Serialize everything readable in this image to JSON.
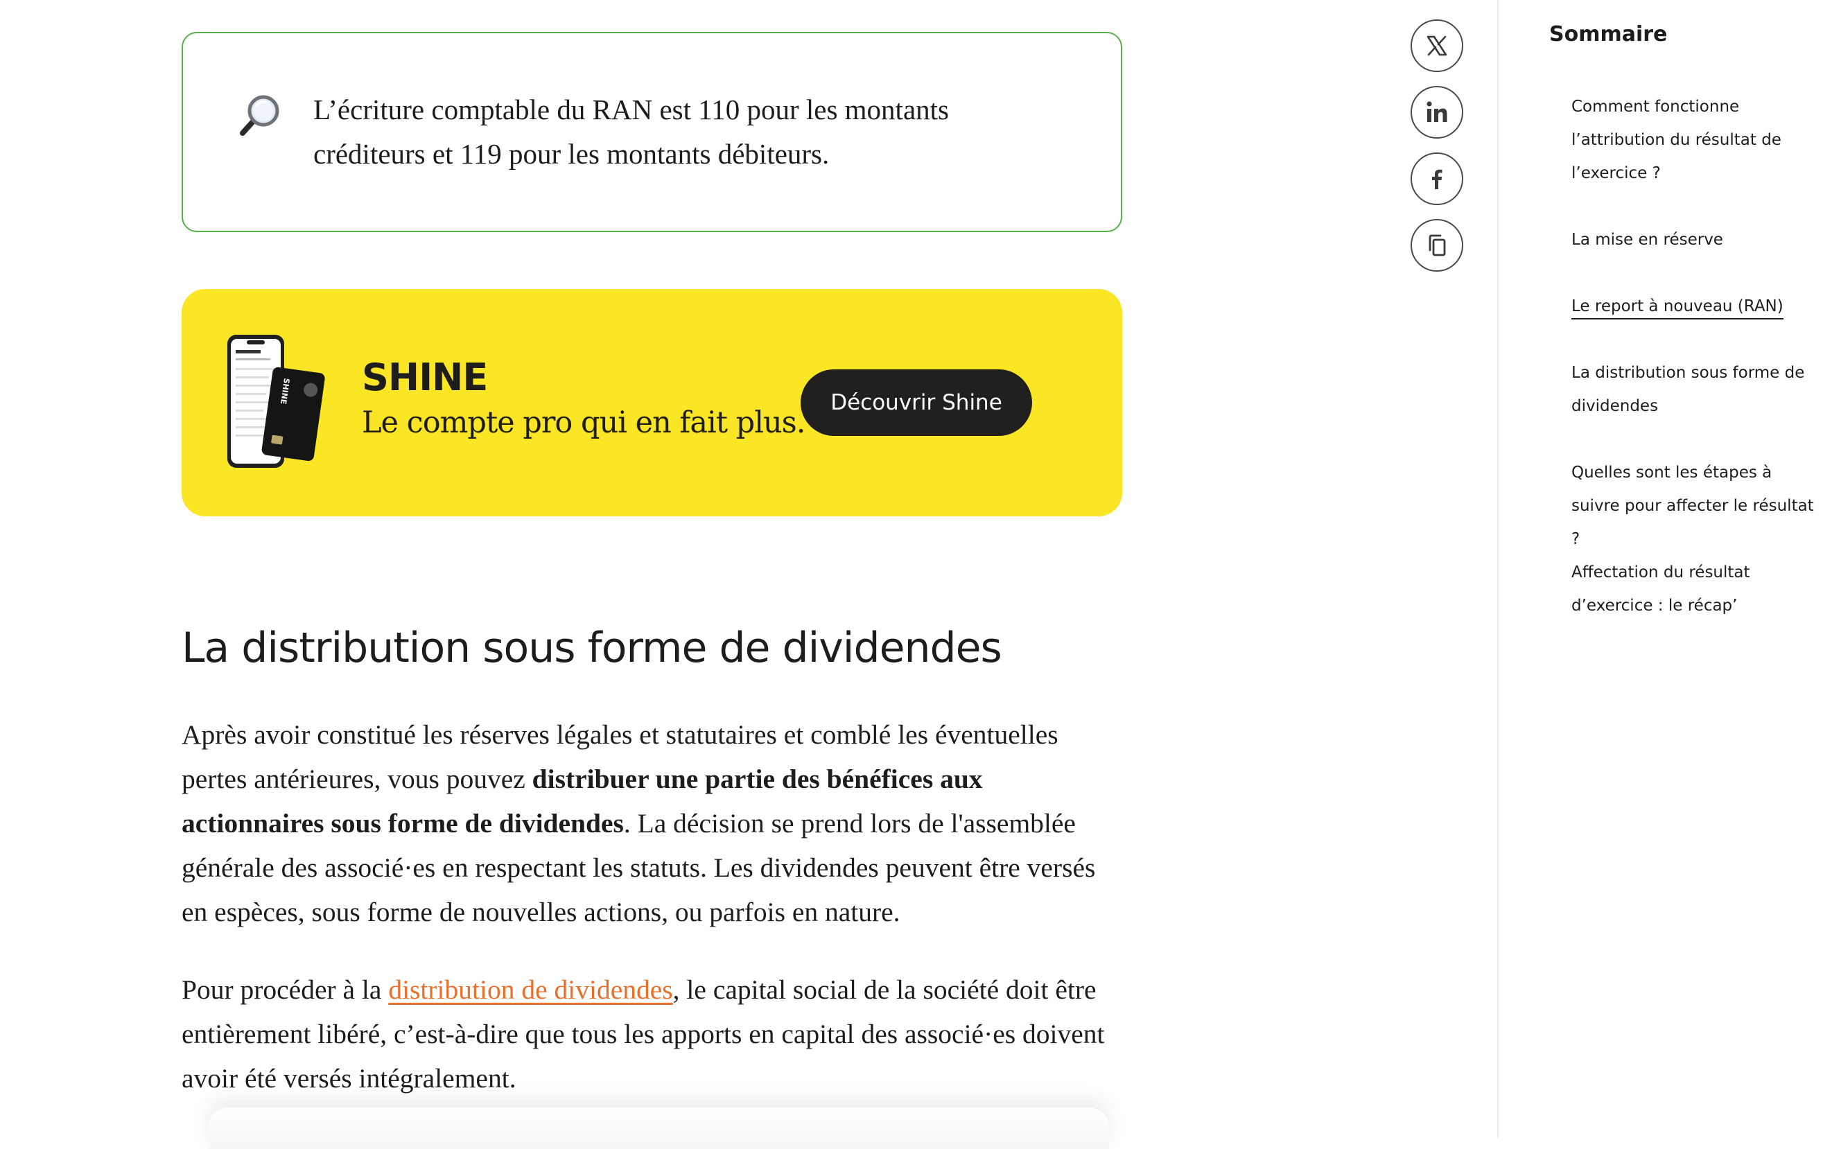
{
  "article": {
    "callout": {
      "icon": "magnifying-glass-icon",
      "text": "L’écriture comptable du RAN est 110 pour les montants créditeurs et 119 pour les montants débiteurs."
    },
    "promo": {
      "brand": "SHINE",
      "tagline": "Le compte pro qui en fait plus.",
      "button_label": "Découvrir Shine",
      "background_color": "#fbe626",
      "button_color": "#22201e",
      "visual": "phone-and-card-image"
    },
    "section_heading": "La distribution sous forme de dividendes",
    "paragraph1": {
      "part1": "Après avoir constitué les réserves légales et statutaires et comblé les éventuelles pertes antérieures, vous pouvez ",
      "bold": "distribuer une partie des bénéfices aux actionnaires sous forme de dividendes",
      "part2": ". La décision se prend lors de l'assemblée générale des associé·es en respectant les statuts. Les dividendes peuvent être versés en espèces, sous forme de nouvelles actions, ou parfois en nature."
    },
    "paragraph2": {
      "part1": "Pour procéder à la ",
      "link_text": "distribution de dividendes",
      "part2": ", le capital social de la société doit être entièrement libéré, c’est-à-dire que tous les apports en capital des associé·es doivent avoir été versés intégralement."
    },
    "link_color": "#e8702a",
    "callout_border_color": "#57b04a"
  },
  "share": [
    {
      "icon": "x-twitter-icon"
    },
    {
      "icon": "linkedin-icon"
    },
    {
      "icon": "facebook-icon"
    },
    {
      "icon": "copy-icon"
    }
  ],
  "toc": {
    "title": "Sommaire",
    "items": [
      {
        "label": "Comment fonctionne l’attribution du résultat de l’exercice ?"
      },
      {
        "label": "La mise en réserve"
      },
      {
        "label": "Le report à nouveau (RAN)",
        "active": true
      },
      {
        "label": "La distribution sous forme de dividendes"
      },
      {
        "label": "Quelles sont les étapes à suivre pour affecter le résultat ?"
      },
      {
        "label": "Affectation du résultat d’exercice : le récap’"
      }
    ]
  }
}
